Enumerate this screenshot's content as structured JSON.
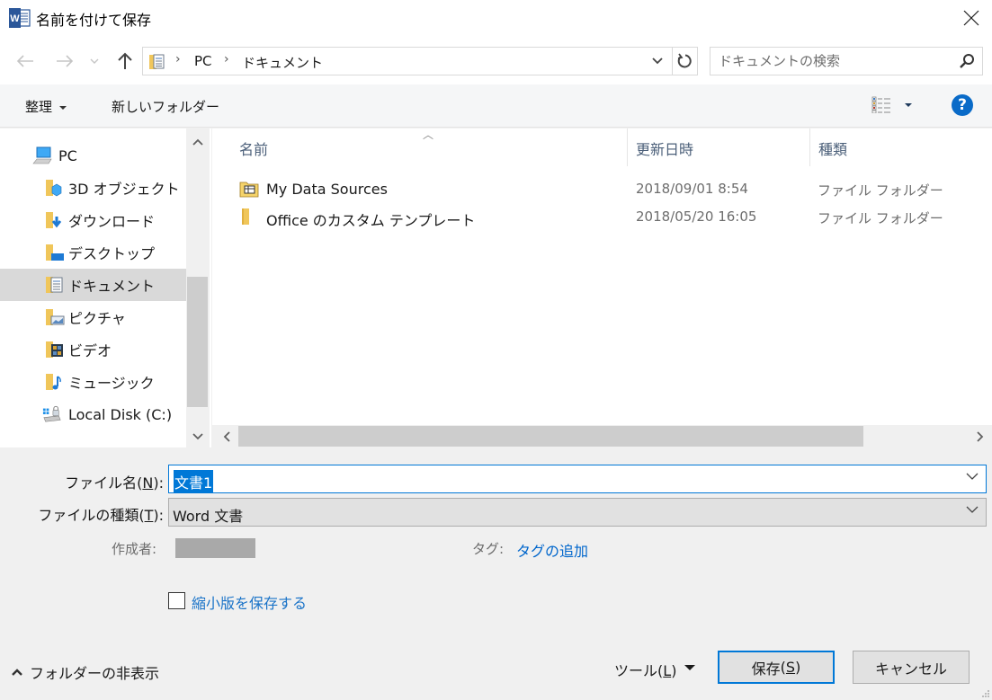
{
  "window": {
    "title": "名前を付けて保存",
    "app_icon": "word-icon",
    "close_icon": "close-icon"
  },
  "navigation": {
    "back_icon": "arrow-left-icon",
    "forward_icon": "arrow-right-icon",
    "recent_icon": "chevron-down-icon",
    "up_icon": "arrow-up-icon",
    "breadcrumb": [
      "PC",
      "ドキュメント"
    ],
    "breadcrumb_icon": "documents-folder-icon",
    "refresh_icon": "refresh-icon",
    "search_placeholder": "ドキュメントの検索",
    "search_icon": "search-icon"
  },
  "toolbar": {
    "organize_label": "整理",
    "new_folder_label": "新しいフォルダー",
    "view_icon": "details-view-icon",
    "help_label": "?"
  },
  "tree": {
    "items": [
      {
        "label": "PC",
        "icon": "pc-icon",
        "selected": false
      },
      {
        "label": "3D オブジェクト",
        "icon": "3d-objects-folder-icon",
        "selected": false
      },
      {
        "label": "ダウンロード",
        "icon": "downloads-folder-icon",
        "selected": false
      },
      {
        "label": "デスクトップ",
        "icon": "desktop-folder-icon",
        "selected": false
      },
      {
        "label": "ドキュメント",
        "icon": "documents-folder-icon",
        "selected": true
      },
      {
        "label": "ピクチャ",
        "icon": "pictures-folder-icon",
        "selected": false
      },
      {
        "label": "ビデオ",
        "icon": "videos-folder-icon",
        "selected": false
      },
      {
        "label": "ミュージック",
        "icon": "music-folder-icon",
        "selected": false
      },
      {
        "label": "Local Disk (C:)",
        "icon": "local-disk-icon",
        "selected": false
      }
    ]
  },
  "file_list": {
    "columns": [
      "名前",
      "更新日時",
      "種類"
    ],
    "sorted_column": "名前",
    "rows": [
      {
        "name": "My Data Sources",
        "modified": "2018/09/01 8:54",
        "type": "ファイル フォルダー",
        "icon": "data-sources-folder-icon"
      },
      {
        "name": "Office のカスタム テンプレート",
        "modified": "2018/05/20 16:05",
        "type": "ファイル フォルダー",
        "icon": "folder-icon"
      }
    ]
  },
  "form": {
    "filename_label": "ファイル名",
    "filename_accel": "N",
    "filename_value": "文書1",
    "filetype_label": "ファイルの種類",
    "filetype_accel": "T",
    "filetype_value": "Word 文書",
    "author_label": "作成者:",
    "tags_label": "タグ:",
    "tags_link": "タグの追加",
    "thumbnail_label": "縮小版を保存する",
    "thumbnail_checked": false
  },
  "footer": {
    "hide_folders_label": "フォルダーの非表示",
    "tools_label": "ツール",
    "tools_accel": "L",
    "save_label": "保存",
    "save_accel": "S",
    "cancel_label": "キャンセル"
  },
  "colors": {
    "accent": "#0078d7",
    "link": "#0066cc",
    "selection_bg": "#d9d9d9",
    "header_text": "#4c607a"
  }
}
